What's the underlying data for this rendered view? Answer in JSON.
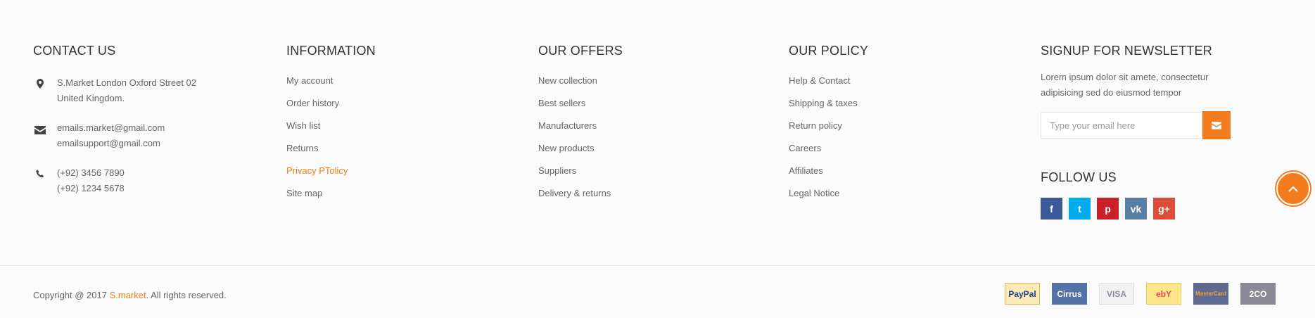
{
  "contact": {
    "title": "CONTACT US",
    "address_line1": "S.Market London Oxford Street 02",
    "address_line2": "United Kingdom.",
    "email1": "emails.market@gmail.com",
    "email2": "emailsupport@gmail.com",
    "phone1": "(+92) 3456 7890",
    "phone2": "(+92) 1234 5678"
  },
  "information": {
    "title": "INFORMATION",
    "links": [
      "My account",
      "Order history",
      "Wish list",
      "Returns",
      "Privacy PTolicy",
      "Site map"
    ]
  },
  "offers": {
    "title": "OUR OFFERS",
    "links": [
      "New collection",
      "Best sellers",
      "Manufacturers",
      "New products",
      "Suppliers",
      "Delivery & returns"
    ]
  },
  "policy": {
    "title": "OUR POLICY",
    "links": [
      "Help & Contact",
      "Shipping & taxes",
      "Return policy",
      "Careers",
      "Affiliates",
      "Legal Notice"
    ]
  },
  "newsletter": {
    "title": "SIGNUP FOR NEWSLETTER",
    "text": "Lorem ipsum dolor sit amete, consectetur adipisicing sed do eiusmod tempor",
    "placeholder": "Type your email here",
    "submit_icon": "envelope-icon"
  },
  "follow": {
    "title": "FOLLOW US",
    "networks": [
      {
        "name": "facebook-icon",
        "glyph": "f",
        "color": "#3b5998"
      },
      {
        "name": "twitter-icon",
        "glyph": "t",
        "color": "#00aced"
      },
      {
        "name": "pinterest-icon",
        "glyph": "p",
        "color": "#cb2027"
      },
      {
        "name": "vk-icon",
        "glyph": "vk",
        "color": "#587ea3"
      },
      {
        "name": "google-plus-icon",
        "glyph": "g+",
        "color": "#dd4b39"
      }
    ]
  },
  "colors": {
    "accent": "#f47c1c",
    "link_active": "#e8801a"
  },
  "back_to_top_icon": "chevron-up-icon",
  "bottom": {
    "copyright_prefix": "Copyright @ 2017 ",
    "brand": "S.market",
    "copyright_suffix": ". All rights reserved.",
    "payments": [
      {
        "name": "paypal-logo",
        "label": "PayPal",
        "bg": "#fbe9b7",
        "fg": "#1f3f8a",
        "border": "#d9b96a"
      },
      {
        "name": "cirrus-logo",
        "label": "Cirrus",
        "bg": "#5472a6",
        "fg": "#ffffff",
        "border": "#5472a6"
      },
      {
        "name": "visa-logo",
        "label": "VISA",
        "bg": "#f2f2f2",
        "fg": "#8a8fa0",
        "border": "#e0e0e0"
      },
      {
        "name": "ebay-logo",
        "label": "ebY",
        "bg": "#fbe78a",
        "fg": "#e8475a",
        "border": "#e6cf6a"
      },
      {
        "name": "mastercard-logo",
        "label": "MasterCard",
        "bg": "#5e6a8f",
        "fg": "#f5a23a",
        "border": "#5e6a8f"
      },
      {
        "name": "2co-logo",
        "label": "2CO",
        "bg": "#8a8a98",
        "fg": "#ffffff",
        "border": "#8a8a98"
      }
    ]
  }
}
